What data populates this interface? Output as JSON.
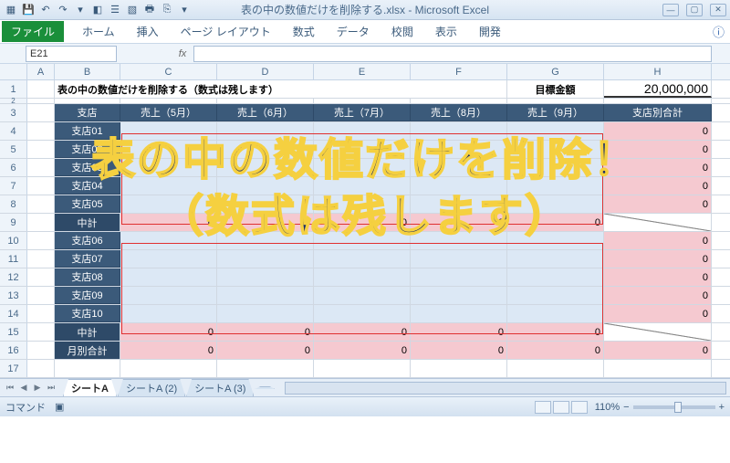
{
  "window": {
    "title": "表の中の数値だけを削除する.xlsx - Microsoft Excel"
  },
  "ribbon": {
    "file": "ファイル",
    "tabs": [
      "ホーム",
      "挿入",
      "ページ レイアウト",
      "数式",
      "データ",
      "校閲",
      "表示",
      "開発"
    ]
  },
  "namebox": "E21",
  "fx": "fx",
  "cols": [
    "A",
    "B",
    "C",
    "D",
    "E",
    "F",
    "G",
    "H"
  ],
  "rownums": [
    "1",
    "2",
    "3",
    "4",
    "5",
    "6",
    "7",
    "8",
    "9",
    "10",
    "11",
    "12",
    "13",
    "14",
    "15",
    "16",
    "17"
  ],
  "r1": {
    "title": "表の中の数値だけを削除する（数式は残します）",
    "goal_lbl": "目標金額",
    "goal_val": "20,000,000"
  },
  "hdr": {
    "shiten": "支店",
    "cols": [
      "売上（5月）",
      "売上（6月）",
      "売上（7月）",
      "売上（8月）",
      "売上（9月）"
    ],
    "total": "支店別合計"
  },
  "shops1": [
    "支店01",
    "支店02",
    "支店03",
    "支店04",
    "支店05"
  ],
  "sub1": "中計",
  "shops2": [
    "支店06",
    "支店07",
    "支店08",
    "支店09",
    "支店10"
  ],
  "sub2": "中計",
  "mtotal": "月別合計",
  "zero": "0",
  "tabs": [
    "シートA",
    "シートA (2)",
    "シートA (3)"
  ],
  "status": {
    "label": "コマンド",
    "zoom": "110%"
  },
  "overlay": {
    "l1": "表の中の数値だけを削除！",
    "l2": "（数式は残します）"
  }
}
